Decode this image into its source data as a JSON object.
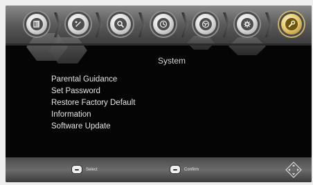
{
  "tabs": [
    {
      "name": "tab-media",
      "icon": "media-icon"
    },
    {
      "name": "tab-channels",
      "icon": "channels-icon"
    },
    {
      "name": "tab-search",
      "icon": "search-icon"
    },
    {
      "name": "tab-timer",
      "icon": "timer-icon"
    },
    {
      "name": "tab-network",
      "icon": "network-icon"
    },
    {
      "name": "tab-settings",
      "icon": "gear-icon"
    },
    {
      "name": "tab-system",
      "icon": "wrench-icon",
      "active": true
    }
  ],
  "page": {
    "title": "System"
  },
  "menu": {
    "items": [
      {
        "label": "Parental Guidance"
      },
      {
        "label": "Set Password"
      },
      {
        "label": "Restore Factory Default"
      },
      {
        "label": "Information"
      },
      {
        "label": "Software Update"
      }
    ]
  },
  "footer": {
    "hints": [
      {
        "label": "Select",
        "icon": "select-key-icon"
      },
      {
        "label": "Confirm",
        "icon": "ok-key-icon"
      }
    ],
    "nav_icon": "dpad-icon"
  },
  "colors": {
    "background": "#050505",
    "text": "#e4e4e4",
    "active_tab": "#e6c76a"
  }
}
